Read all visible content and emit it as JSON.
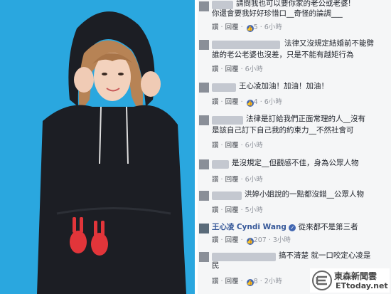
{
  "colors": {
    "photo_bg": "#2aa7df",
    "hoodie": "#1c1e24",
    "comments_bg": "#f5f6f7",
    "name_link": "#365899",
    "like_blue": "#4267b2"
  },
  "comments": [
    {
      "line1": "請問我也可以要你家的老公或老婆!",
      "line2": "你還會要我好好珍惜口__奇怪的論調___",
      "reply": "回覆",
      "likes": "5",
      "time": "6小時"
    },
    {
      "line1": "法律又沒規定結婚前不能劈",
      "line2": "誰的老公老婆也沒差，只是不能有越矩行為",
      "reply": "回覆",
      "time": "6小時"
    },
    {
      "line1": "王心凌加油！加油！加油！",
      "reply": "回覆",
      "likes": "4",
      "time": "6小時"
    },
    {
      "line1": "法律是訂給我們正面常理的人__沒有",
      "line2": "是該自己訂下自己我的約束力__不然社會可",
      "reply": "回覆",
      "time": "6小時"
    },
    {
      "line1": "是沒規定__但觀感不佳，身為公眾人物",
      "reply": "回覆",
      "time": "6小時"
    },
    {
      "line1": "洪婷小姐說的一點都沒錯__公眾人物",
      "reply": "回覆",
      "time": "5小時"
    },
    {
      "name": "王心凌",
      "name_en": "Cyndi Wang",
      "line1": "從來都不是第三者",
      "reply": "回覆",
      "likes": "207",
      "time": "3小時"
    },
    {
      "line1": "搞不清楚 就一口咬定心凌是",
      "line2": "民",
      "reply": "回覆",
      "likes": "8",
      "time": "2小時"
    }
  ],
  "labels": {
    "reply_prefix": "讚"
  },
  "watermark": {
    "name": "東森新聞雲",
    "site": "ETtoday.net"
  },
  "photo": {
    "icons": [
      "bunny-left",
      "bunny-right"
    ]
  }
}
